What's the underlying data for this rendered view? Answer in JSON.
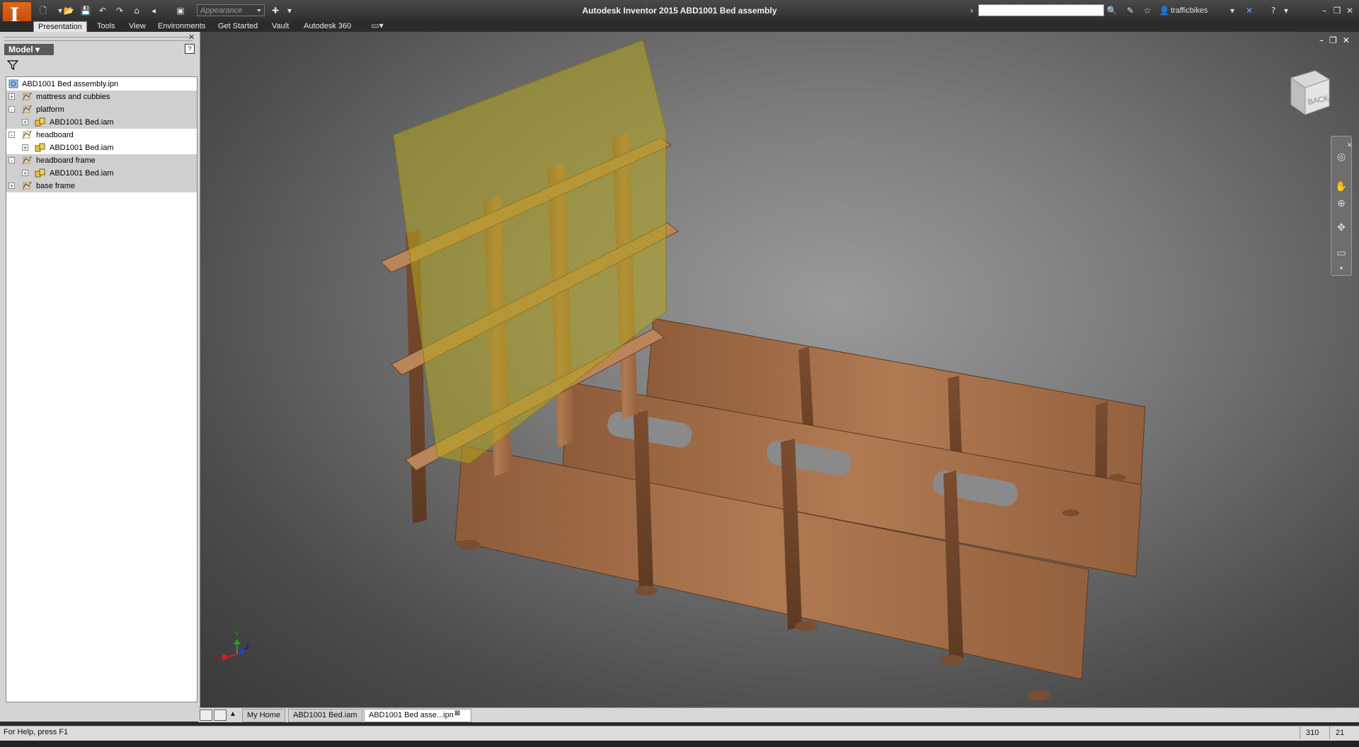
{
  "app": {
    "title": "Autodesk Inventor 2015    ABD1001 Bed assembly",
    "logo_letter": "I",
    "appearance_placeholder": "Appearance",
    "username": "trafficbikes"
  },
  "ribbon": {
    "tabs": [
      "Presentation",
      "Tools",
      "View",
      "Environments",
      "Get Started",
      "Vault",
      "Autodesk 360"
    ],
    "active_tab": "Presentation"
  },
  "browser": {
    "header": "Model ▾",
    "items": [
      {
        "label": "ABD1001 Bed assembly.ipn",
        "level": 0,
        "icon": "presentation-file-icon",
        "expander": ""
      },
      {
        "label": "mattress and cubbies",
        "level": 1,
        "icon": "view-icon",
        "expander": "+"
      },
      {
        "label": "platform",
        "level": 1,
        "icon": "view-icon",
        "expander": "-"
      },
      {
        "label": "ABD1001 Bed.iam",
        "level": 2,
        "icon": "assembly-icon",
        "expander": "+"
      },
      {
        "label": "headboard",
        "level": 1,
        "icon": "view-icon",
        "expander": "-"
      },
      {
        "label": "ABD1001 Bed.iam",
        "level": 2,
        "icon": "assembly-icon",
        "expander": "+"
      },
      {
        "label": "headboard frame",
        "level": 1,
        "icon": "view-icon",
        "expander": "-"
      },
      {
        "label": "ABD1001 Bed.iam",
        "level": 2,
        "icon": "assembly-icon",
        "expander": "+"
      },
      {
        "label": "base frame",
        "level": 1,
        "icon": "view-icon",
        "expander": "+"
      }
    ],
    "selected_rows": [
      1,
      2,
      3,
      6,
      7,
      8
    ]
  },
  "viewport": {
    "viewcube_face": "BACK",
    "triad": {
      "x": "X",
      "y": "Y",
      "z": "Z"
    },
    "colors": {
      "wood": "#a8714a",
      "glass": "#b5a51e"
    }
  },
  "doc_tabs": {
    "items": [
      "My Home",
      "ABD1001 Bed.iam",
      "ABD1001 Bed asse...ipn"
    ],
    "active": 2
  },
  "status": {
    "help_text": "For Help, press F1",
    "count1": "310",
    "count2": "21"
  }
}
